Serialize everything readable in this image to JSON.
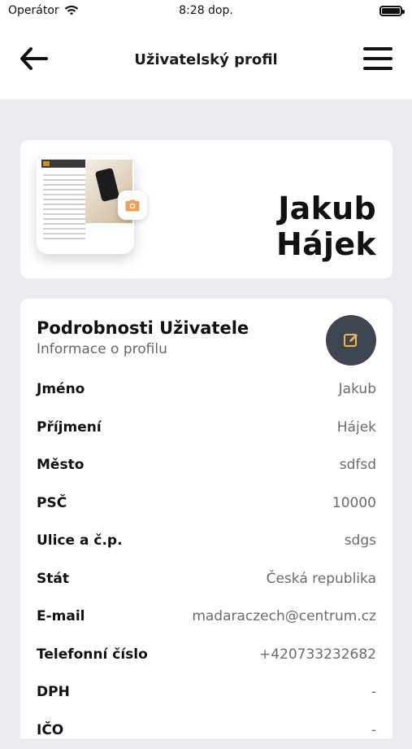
{
  "status_bar": {
    "carrier": "Operátor",
    "time": "8:28 dop."
  },
  "navbar": {
    "title": "Uživatelský profil"
  },
  "profile": {
    "name": "Jakub Hájek"
  },
  "details": {
    "title": "Podrobnosti Uživatele",
    "subtitle": "Informace o profilu",
    "rows": [
      {
        "label": "Jméno",
        "value": "Jakub"
      },
      {
        "label": "Příjmení",
        "value": "Hájek"
      },
      {
        "label": "Město",
        "value": "sdfsd"
      },
      {
        "label": "PSČ",
        "value": "10000"
      },
      {
        "label": "Ulice a č.p.",
        "value": "sdgs"
      },
      {
        "label": "Stát",
        "value": "Česká republika"
      },
      {
        "label": "E-mail",
        "value": "madaraczech@centrum.cz"
      },
      {
        "label": "Telefonní číslo",
        "value": "+420733232682"
      },
      {
        "label": "DPH",
        "value": "-"
      },
      {
        "label": "IČO",
        "value": "-"
      }
    ]
  },
  "colors": {
    "background": "#e9ebef",
    "card": "#ffffff",
    "edit_button": "#3f4650",
    "accent_camera": "#e8a15c"
  },
  "icons": [
    "wifi-icon",
    "battery-icon",
    "back-arrow-icon",
    "hamburger-menu-icon",
    "camera-icon",
    "edit-icon"
  ]
}
